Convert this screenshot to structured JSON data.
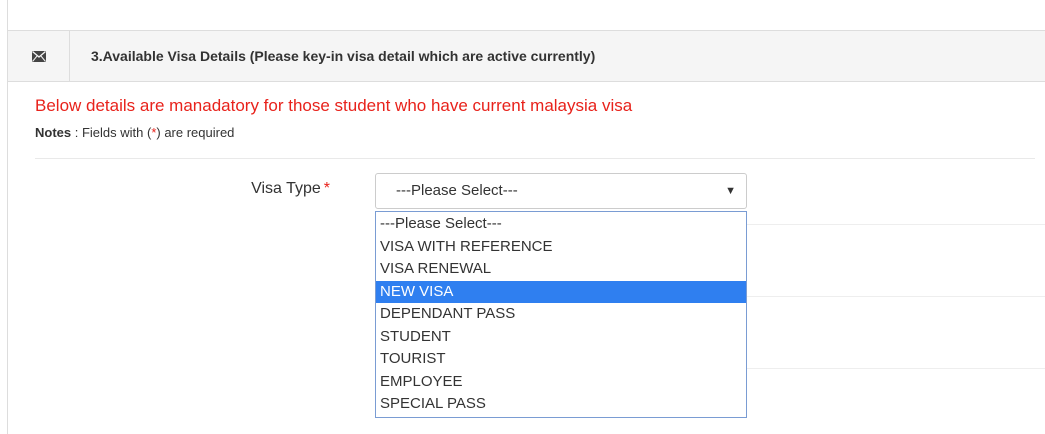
{
  "panel": {
    "title": "3.Available Visa Details (Please key-in visa detail which are active currently)",
    "icon": "envelope-icon"
  },
  "mandatory_message": "Below details are manadatory for those student who have current malaysia visa",
  "notes": {
    "label": "Notes",
    "text_before": " : Fields with (",
    "required_mark": "*",
    "text_after": ") are required"
  },
  "visa_type": {
    "label": "Visa Type",
    "required_mark": "*",
    "selected_value": "---Please Select---",
    "caret": "▼",
    "options": [
      "---Please Select---",
      "VISA WITH REFERENCE",
      "VISA RENEWAL",
      "NEW VISA",
      "DEPENDANT PASS",
      "STUDENT",
      "TOURIST",
      "EMPLOYEE",
      "SPECIAL PASS"
    ],
    "highlighted_option": "NEW VISA"
  },
  "colors": {
    "required_red": "#e8221b",
    "highlight_blue": "#2f7ff0",
    "header_bg": "#f5f5f5"
  }
}
